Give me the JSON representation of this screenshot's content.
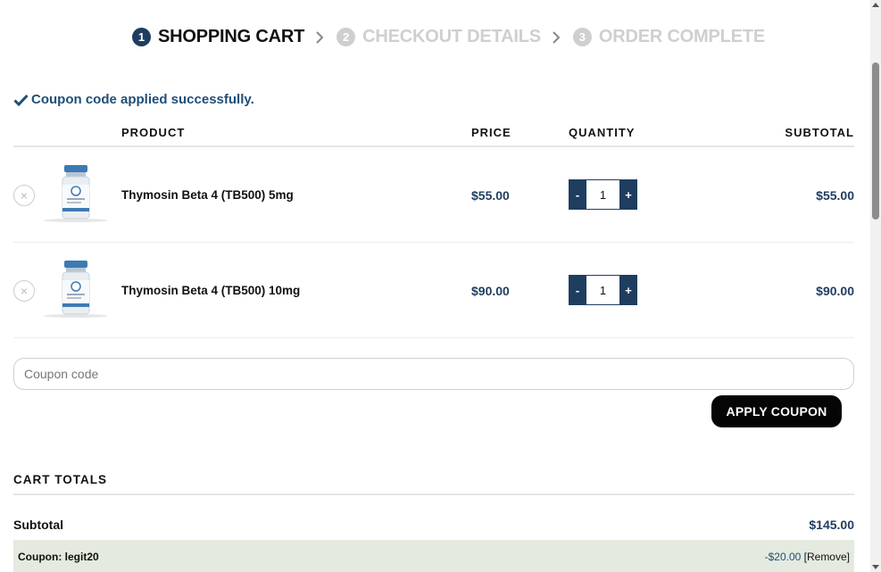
{
  "steps": [
    {
      "number": "1",
      "label": "SHOPPING CART",
      "active": true
    },
    {
      "number": "2",
      "label": "CHECKOUT DETAILS",
      "active": false
    },
    {
      "number": "3",
      "label": "ORDER COMPLETE",
      "active": false
    }
  ],
  "notice": {
    "message": "Coupon code applied successfully."
  },
  "table": {
    "headers": {
      "product": "PRODUCT",
      "price": "PRICE",
      "quantity": "QUANTITY",
      "subtotal": "SUBTOTAL"
    },
    "rows": [
      {
        "name": "Thymosin Beta 4 (TB500) 5mg",
        "price": "$55.00",
        "quantity": "1",
        "subtotal": "$55.00"
      },
      {
        "name": "Thymosin Beta 4 (TB500) 10mg",
        "price": "$90.00",
        "quantity": "1",
        "subtotal": "$90.00"
      }
    ],
    "qty_minus": "-",
    "qty_plus": "+",
    "remove_symbol": "×"
  },
  "coupon": {
    "placeholder": "Coupon code",
    "value": "",
    "apply_label": "APPLY COUPON"
  },
  "totals": {
    "title": "CART TOTALS",
    "subtotal_label": "Subtotal",
    "subtotal_value": "$145.00",
    "coupon_label": "Coupon: legit20",
    "coupon_amount": "-$20.00",
    "coupon_remove": "[Remove]"
  },
  "colors": {
    "accent": "#1f3d5f",
    "link": "#1f4e79",
    "coupon_bg": "#e4eadf",
    "button": "#050505"
  }
}
